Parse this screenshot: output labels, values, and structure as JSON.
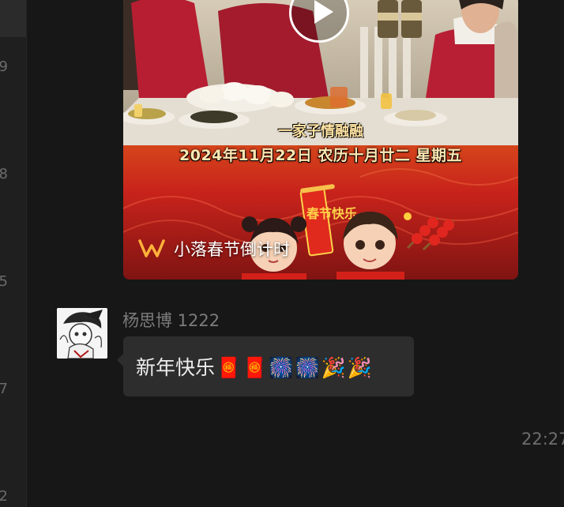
{
  "left_rail": {
    "labels": [
      "9",
      "8",
      "5",
      "7",
      "2"
    ]
  },
  "video_message": {
    "subtitle": "一家子情融融",
    "date_line": "2024年11月22日  农历十月廿二  星期五",
    "source_name": "小落春节倒计时",
    "banner_text": "春节快乐",
    "play_icon": "play-icon",
    "source_icon": "channels-icon"
  },
  "text_message": {
    "sender": "杨思博 1222",
    "text": "新年快乐",
    "emojis": [
      "🧧",
      "🧧",
      "🎆",
      "🎆",
      "🎉",
      "🎉"
    ]
  },
  "timestamp": "22:27",
  "colors": {
    "background": "#171717",
    "bubble": "#2d2d2d",
    "accent_orange": "#ffb23a",
    "banner_red": "#c8231b"
  }
}
